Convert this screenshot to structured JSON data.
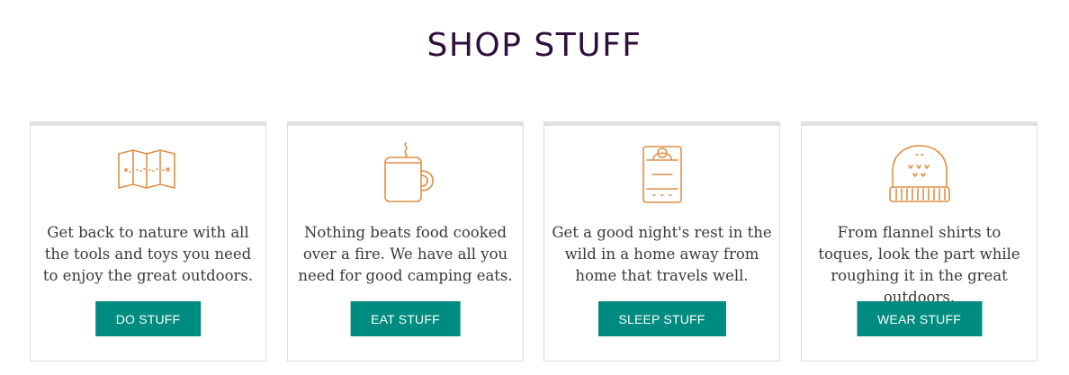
{
  "section": {
    "title": "SHOP STUFF"
  },
  "cards": [
    {
      "icon": "map-icon",
      "text": "Get back to nature with all the tools and toys you need to enjoy the great outdoors.",
      "button_label": "DO STUFF"
    },
    {
      "icon": "mug-icon",
      "text": "Nothing beats food cooked over a fire. We have all you need for good camping eats.",
      "button_label": "EAT STUFF"
    },
    {
      "icon": "sleeping-bag-icon",
      "text": "Get a good night's rest in the wild in a home away from home that travels well.",
      "button_label": "SLEEP STUFF"
    },
    {
      "icon": "toque-icon",
      "text": "From flannel shirts to toques, look the part while roughing it in the great outdoors.",
      "button_label": "WEAR STUFF"
    }
  ],
  "colors": {
    "title": "#2f0f3c",
    "icon_stroke": "#de8f45",
    "button_bg": "#008b80",
    "button_text": "#ffffff",
    "body_text": "#3a3a3a",
    "card_border": "#dcdcdc",
    "card_top_border": "#e1e1e1"
  }
}
